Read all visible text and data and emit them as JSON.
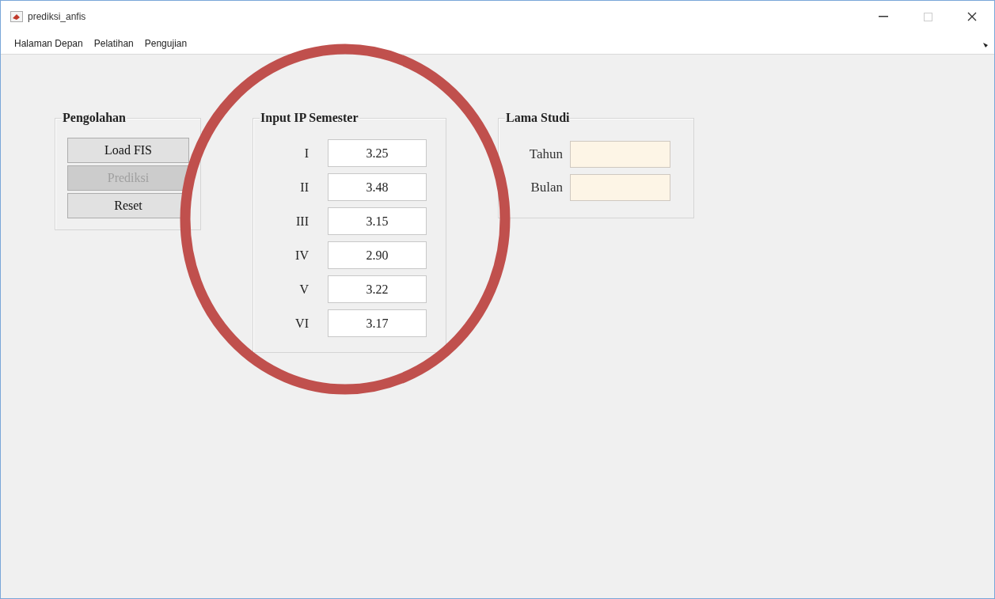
{
  "window": {
    "title": "prediksi_anfis"
  },
  "menu": [
    "Halaman Depan",
    "Pelatihan",
    "Pengujian"
  ],
  "pengolahan": {
    "title": "Pengolahan",
    "buttons": [
      {
        "label": "Load FIS",
        "disabled": false
      },
      {
        "label": "Prediksi",
        "disabled": true
      },
      {
        "label": "Reset",
        "disabled": false
      }
    ]
  },
  "input_ip": {
    "title": "Input IP Semester",
    "rows": [
      {
        "label": "I",
        "value": "3.25"
      },
      {
        "label": "II",
        "value": "3.48"
      },
      {
        "label": "III",
        "value": "3.15"
      },
      {
        "label": "IV",
        "value": "2.90"
      },
      {
        "label": "V",
        "value": "3.22"
      },
      {
        "label": "VI",
        "value": "3.17"
      }
    ]
  },
  "lama_studi": {
    "title": "Lama Studi",
    "fields": [
      {
        "label": "Tahun"
      },
      {
        "label": "Bulan"
      }
    ]
  }
}
